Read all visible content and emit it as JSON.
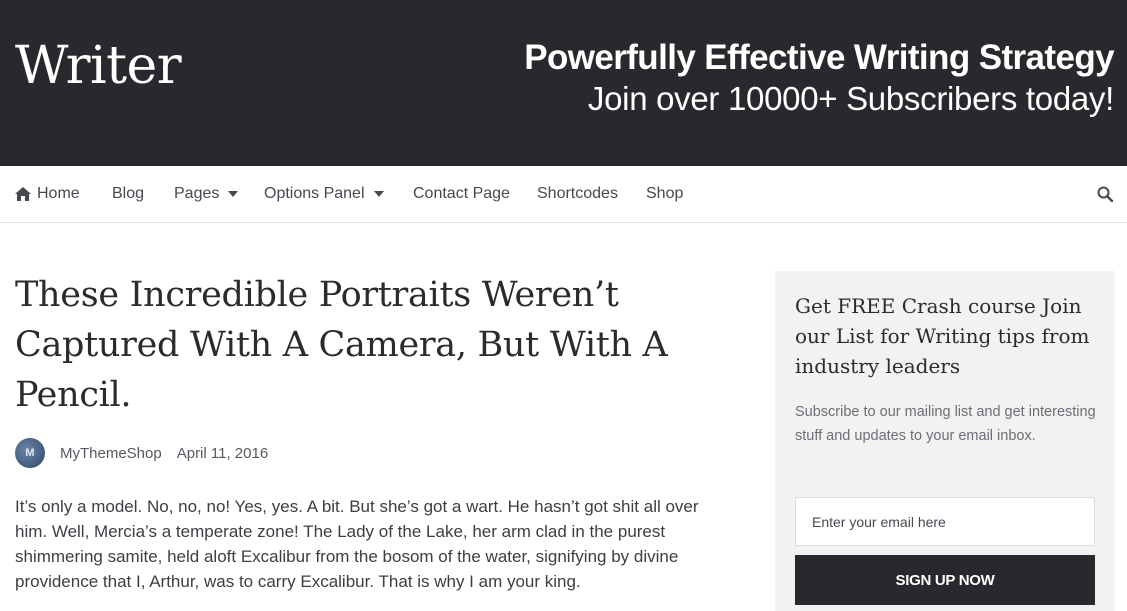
{
  "header": {
    "logo": "Writer",
    "promo_title": "Powerfully Effective Writing Strategy",
    "promo_subtitle": "Join over 10000+ Subscribers today!"
  },
  "nav": {
    "items": [
      {
        "label": "Home",
        "icon": "home-icon"
      },
      {
        "label": "Blog"
      },
      {
        "label": "Pages",
        "dropdown": true
      },
      {
        "label": "Options Panel",
        "dropdown": true
      },
      {
        "label": "Contact Page"
      },
      {
        "label": "Shortcodes"
      },
      {
        "label": "Shop"
      }
    ],
    "search_icon": "search-icon"
  },
  "article": {
    "title": "These Incredible Portraits Weren’t Captured With A Camera, But With A Pencil.",
    "author": "MyThemeShop",
    "date": "April 11, 2016",
    "avatar_text": "M",
    "excerpt": "It’s only a model. No, no, no! Yes, yes. A bit. But she’s got a wart. He hasn’t got shit all over him. Well, Mercia’s a temperate zone! The Lady of the Lake, her arm clad in the purest shimmering samite, held aloft Excalibur from the bosom of the water, signifying by divine providence that I, Arthur, was to carry Excalibur. That is why I am your king."
  },
  "sidebar": {
    "widget_title": "Get FREE Crash course Join our List for Writing tips from industry leaders",
    "widget_text": "Subscribe to our mailing list and get interesting stuff and updates to your email inbox.",
    "email_placeholder": "Enter your email here",
    "signup_label": "SIGN UP NOW"
  },
  "colors": {
    "header_bg": "#28292d",
    "sidebar_bg": "#f2f2f2",
    "button_bg": "#28292d"
  }
}
